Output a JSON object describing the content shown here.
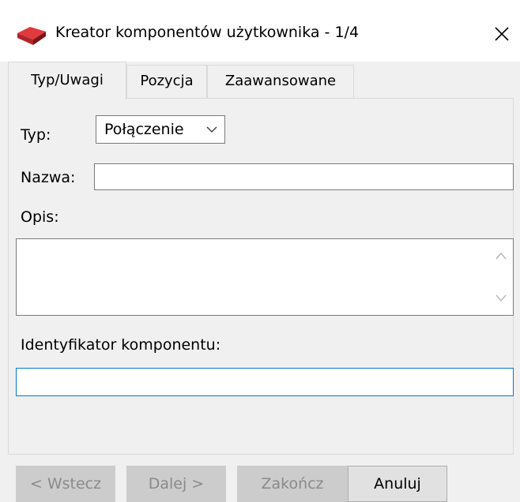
{
  "window": {
    "title": "Kreator komponentów użytkownika - 1/4"
  },
  "tabs": [
    {
      "label": "Typ/Uwagi",
      "active": true
    },
    {
      "label": "Pozycja",
      "active": false
    },
    {
      "label": "Zaawansowane",
      "active": false
    }
  ],
  "form": {
    "type_label": "Typ:",
    "type_value": "Połączenie",
    "name_label": "Nazwa:",
    "name_value": "",
    "description_label": "Opis:",
    "description_value": "",
    "identifier_label": "Identyfikator komponentu:",
    "identifier_value": ""
  },
  "buttons": {
    "back": "< Wstecz",
    "next": "Dalej >",
    "finish": "Zakończ",
    "cancel": "Anuluj"
  },
  "colors": {
    "accent_focus": "#0078d7",
    "icon_red": "#d9262c",
    "icon_dark_red": "#8b1a1f"
  },
  "icons": {
    "app": "red-book-icon",
    "close": "close-icon",
    "dropdown": "chevron-down-icon"
  }
}
